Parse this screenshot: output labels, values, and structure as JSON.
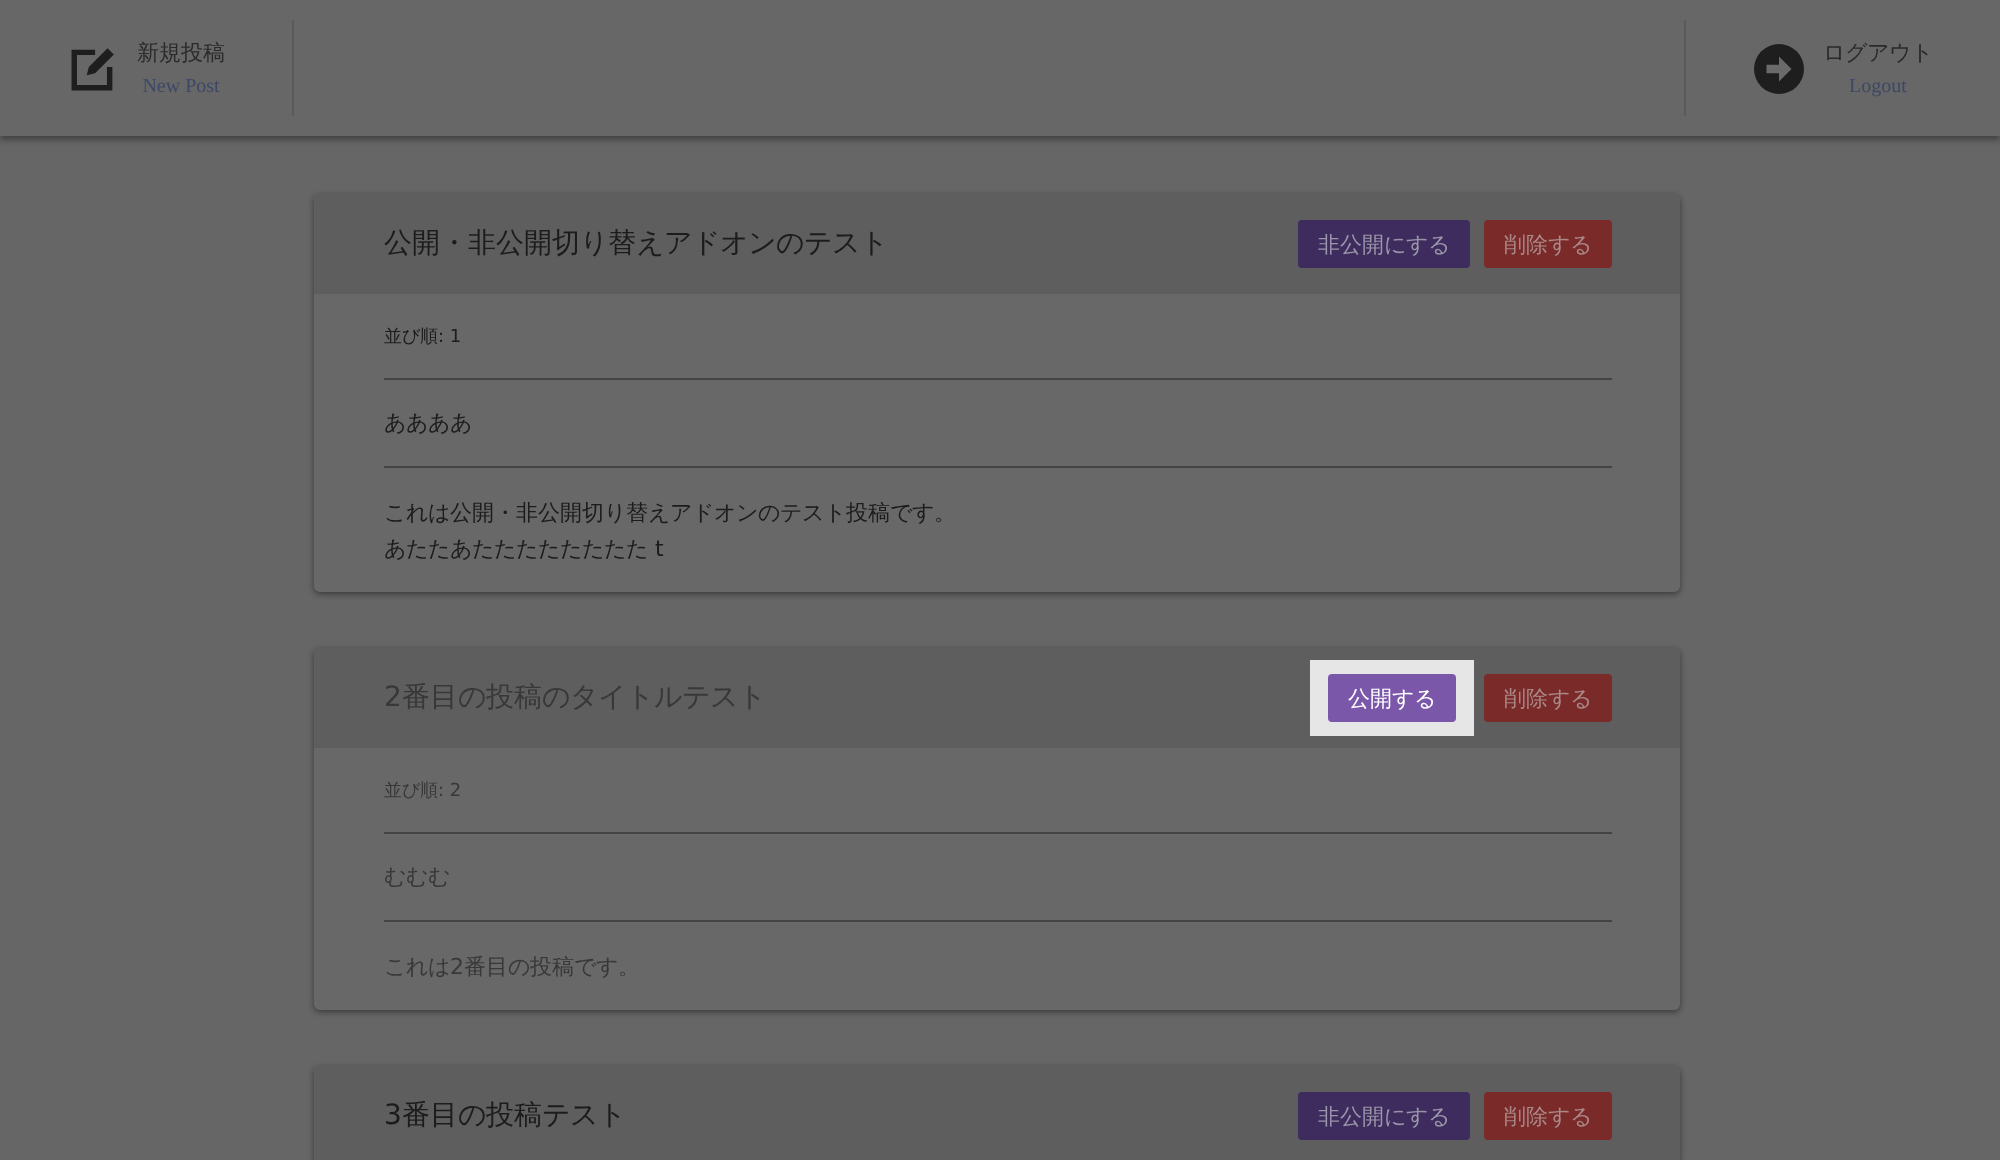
{
  "header": {
    "left": {
      "label": "新規投稿",
      "sublabel": "New Post"
    },
    "right": {
      "label": "ログアウト",
      "sublabel": "Logout"
    }
  },
  "posts": [
    {
      "title": "公開・非公開切り替えアドオンのテスト",
      "published": true,
      "actions": [
        {
          "kind": "toggle",
          "label": "非公開にする",
          "highlighted": false
        },
        {
          "kind": "delete",
          "label": "削除する",
          "highlighted": false
        }
      ],
      "order": "並び順: 1",
      "summary": "ああああ",
      "body": [
        "これは公開・非公開切り替えアドオンのテスト投稿です。",
        "あたたあたたたたたたたた t"
      ]
    },
    {
      "title": "2番目の投稿のタイトルテスト",
      "published": false,
      "actions": [
        {
          "kind": "toggle",
          "label": "公開する",
          "highlighted": true
        },
        {
          "kind": "delete",
          "label": "削除する",
          "highlighted": false
        }
      ],
      "order": "並び順: 2",
      "summary": "むむむ",
      "body": [
        "これは2番目の投稿です。"
      ]
    },
    {
      "title": "3番目の投稿テスト",
      "published": true,
      "actions": [
        {
          "kind": "toggle",
          "label": "非公開にする",
          "highlighted": false
        },
        {
          "kind": "delete",
          "label": "削除する",
          "highlighted": false
        }
      ]
    }
  ]
}
